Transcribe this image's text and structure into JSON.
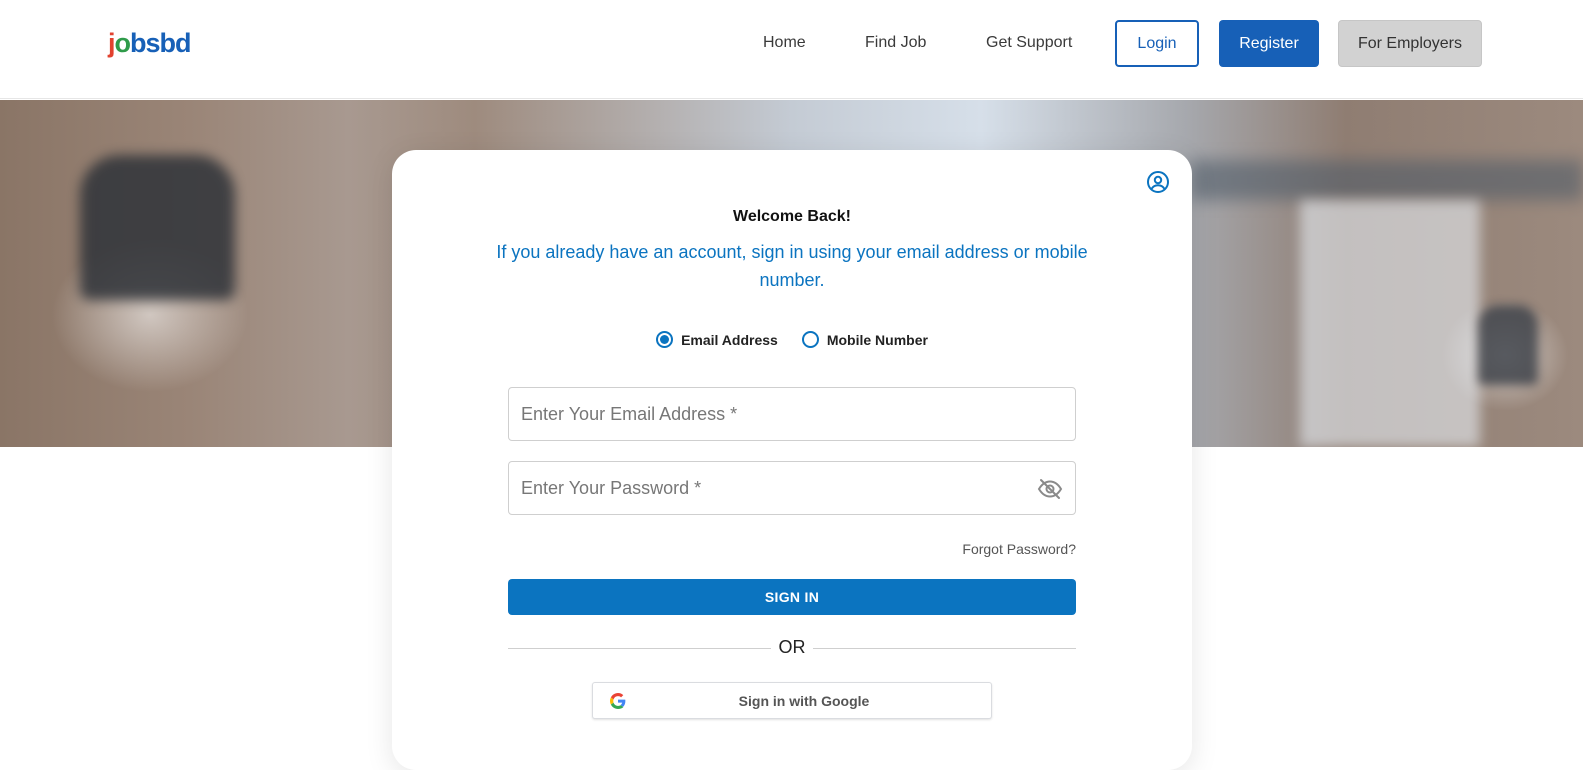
{
  "header": {
    "logo": {
      "part1": "j",
      "part2": "o",
      "part3": "bsbd"
    },
    "nav": [
      "Home",
      "Find Job",
      "Get Support"
    ],
    "login": "Login",
    "register": "Register",
    "employers": "For Employers"
  },
  "card": {
    "welcome": "Welcome Back!",
    "subtitle": "If you already have an account, sign in using your email address or mobile number.",
    "radios": [
      {
        "label": "Email Address",
        "selected": true
      },
      {
        "label": "Mobile Number",
        "selected": false
      }
    ],
    "email_placeholder": "Enter Your Email Address *",
    "password_placeholder": "Enter Your Password *",
    "forgot": "Forgot Password?",
    "signin": "SIGN IN",
    "or": "OR",
    "google": "Sign in with Google"
  },
  "colors": {
    "primary": "#0b74c0",
    "brand_blue": "#1760b7",
    "logo_red": "#e2422f",
    "logo_green": "#2f9b4a"
  },
  "icons": {
    "account": "user-circle-icon",
    "password_toggle": "eye-off-icon",
    "google": "google-g-icon"
  }
}
